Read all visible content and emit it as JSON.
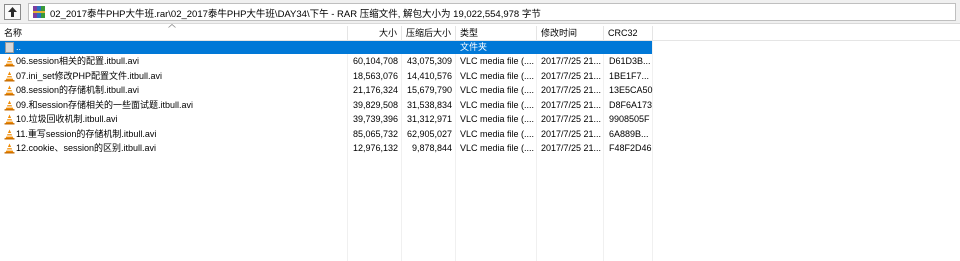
{
  "pathbar": {
    "path": "02_2017泰牛PHP大牛班.rar\\02_2017泰牛PHP大牛班\\DAY34\\下午 - RAR 压缩文件, 解包大小为 19,022,554,978 字节"
  },
  "columns": {
    "name": "名称",
    "size": "大小",
    "packed": "压缩后大小",
    "type": "类型",
    "modified": "修改时间",
    "crc": "CRC32"
  },
  "parent_row": {
    "name": "..",
    "type": "文件夹"
  },
  "files": [
    {
      "name": "06.session相关的配置.itbull.avi",
      "size": "60,104,708",
      "packed": "43,075,309",
      "type": "VLC media file (....",
      "modified": "2017/7/25 21...",
      "crc": "D61D3B..."
    },
    {
      "name": "07.ini_set修改PHP配置文件.itbull.avi",
      "size": "18,563,076",
      "packed": "14,410,576",
      "type": "VLC media file (....",
      "modified": "2017/7/25 21...",
      "crc": "1BE1F7..."
    },
    {
      "name": "08.session的存储机制.itbull.avi",
      "size": "21,176,324",
      "packed": "15,679,790",
      "type": "VLC media file (....",
      "modified": "2017/7/25 21...",
      "crc": "13E5CA50"
    },
    {
      "name": "09.和session存储相关的一些面试题.itbull.avi",
      "size": "39,829,508",
      "packed": "31,538,834",
      "type": "VLC media file (....",
      "modified": "2017/7/25 21...",
      "crc": "D8F6A173"
    },
    {
      "name": "10.垃圾回收机制.itbull.avi",
      "size": "39,739,396",
      "packed": "31,312,971",
      "type": "VLC media file (....",
      "modified": "2017/7/25 21...",
      "crc": "9908505F"
    },
    {
      "name": "11.重写session的存储机制.itbull.avi",
      "size": "85,065,732",
      "packed": "62,905,027",
      "type": "VLC media file (....",
      "modified": "2017/7/25 21...",
      "crc": "6A889B..."
    },
    {
      "name": "12.cookie、session的区别.itbull.avi",
      "size": "12,976,132",
      "packed": "9,878,844",
      "type": "VLC media file (....",
      "modified": "2017/7/25 21...",
      "crc": "F48F2D46"
    }
  ],
  "colors": {
    "selection": "#0078d7",
    "vlc_orange": "#f08a00"
  },
  "icons": {
    "up": "folder-up-icon",
    "archive": "winrar-archive-icon",
    "parent": "parent-folder-icon",
    "file": "vlc-cone-icon"
  }
}
